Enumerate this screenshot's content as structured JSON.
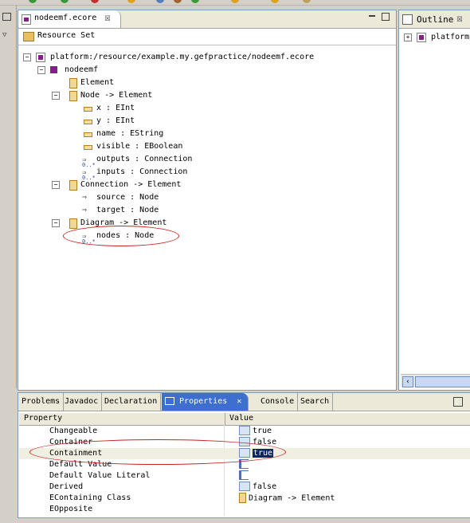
{
  "editor": {
    "tab_title": "nodeemf.ecore",
    "resource_set": "Resource Set",
    "tree": {
      "root": "platform:/resource/example.my.gefpractice/nodeemf.ecore",
      "package": "nodeemf",
      "items": [
        {
          "label": "Element"
        },
        {
          "label": "Node -> Element"
        },
        {
          "label": "x : EInt"
        },
        {
          "label": "y : EInt"
        },
        {
          "label": "name : EString"
        },
        {
          "label": "visible : EBoolean"
        },
        {
          "label": "outputs : Connection"
        },
        {
          "label": "inputs : Connection"
        },
        {
          "label": "Connection -> Element"
        },
        {
          "label": "source : Node"
        },
        {
          "label": "target : Node"
        },
        {
          "label": "Diagram -> Element"
        },
        {
          "label": "nodes : Node"
        }
      ]
    }
  },
  "outline": {
    "title": "Outline",
    "item": "platform"
  },
  "properties": {
    "tabs": [
      "Problems",
      "Javadoc",
      "Declaration",
      "Properties",
      "Console",
      "Search"
    ],
    "active_tab": "Properties",
    "columns": [
      "Property",
      "Value"
    ],
    "rows": [
      {
        "name": "Changeable",
        "value": "true"
      },
      {
        "name": "Container",
        "value": "false"
      },
      {
        "name": "Containment",
        "value": "true"
      },
      {
        "name": "Default Value",
        "value": ""
      },
      {
        "name": "Default Value Literal",
        "value": ""
      },
      {
        "name": "Derived",
        "value": "false"
      },
      {
        "name": "EContaining Class",
        "value": "Diagram -> Element"
      },
      {
        "name": "EOpposite",
        "value": ""
      }
    ]
  },
  "colors": {
    "active_tab": "#3d6fd1",
    "annotation": "#cc2020",
    "class_icon": "#d8a640",
    "package_icon": "#8a1b8a"
  }
}
